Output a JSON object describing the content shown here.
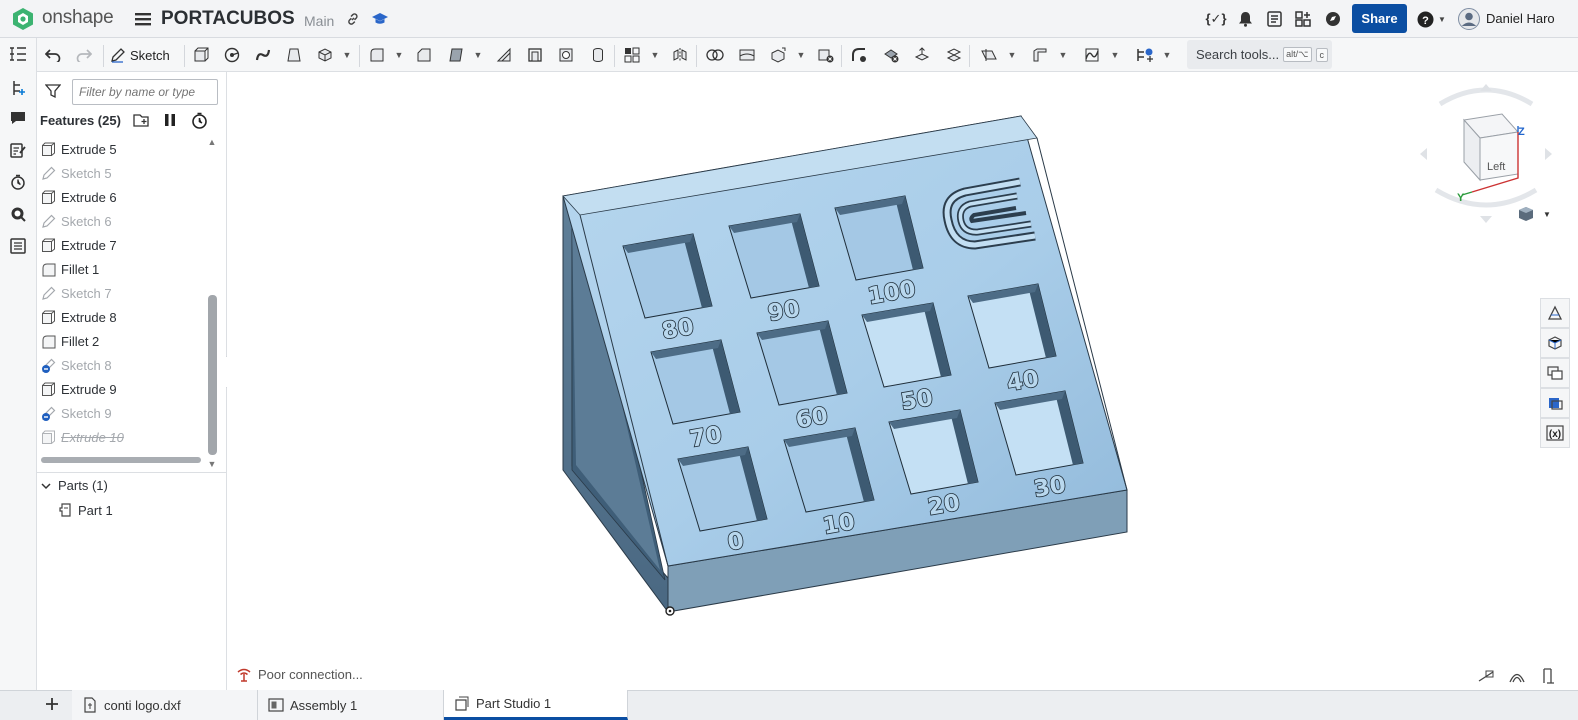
{
  "app": {
    "brand": "onshape",
    "document_title": "PORTACUBOS",
    "branch": "Main",
    "share_label": "Share",
    "user_name": "Daniel Haro",
    "accent_color": "#0b4ea2",
    "brand_color": "#3cb371"
  },
  "toolbar": {
    "sketch_label": "Sketch",
    "search_label": "Search tools...",
    "search_shortcut_1": "alt/⌥",
    "search_shortcut_2": "c"
  },
  "features": {
    "filter_placeholder": "Filter by name or type",
    "header": "Features (25)",
    "items": [
      {
        "label": "Extrude 5",
        "kind": "extrude"
      },
      {
        "label": "Sketch 5",
        "kind": "sketch"
      },
      {
        "label": "Extrude 6",
        "kind": "extrude"
      },
      {
        "label": "Sketch 6",
        "kind": "sketch"
      },
      {
        "label": "Extrude 7",
        "kind": "extrude"
      },
      {
        "label": "Fillet 1",
        "kind": "fillet"
      },
      {
        "label": "Sketch 7",
        "kind": "sketch"
      },
      {
        "label": "Extrude 8",
        "kind": "extrude"
      },
      {
        "label": "Fillet 2",
        "kind": "fillet"
      },
      {
        "label": "Sketch 8",
        "kind": "sketch-error"
      },
      {
        "label": "Extrude 9",
        "kind": "extrude"
      },
      {
        "label": "Sketch 9",
        "kind": "sketch-error"
      },
      {
        "label": "Extrude 10",
        "kind": "suppressed"
      }
    ],
    "parts_header": "Parts (1)",
    "parts": [
      "Part 1"
    ]
  },
  "model": {
    "labels": [
      "80",
      "90",
      "100",
      "70",
      "60",
      "50",
      "40",
      "0",
      "10",
      "20",
      "30"
    ]
  },
  "viewcube": {
    "face_label": "Left",
    "axis_z": "Z",
    "axis_y": "Y"
  },
  "status": {
    "connection": "Poor connection..."
  },
  "tabs": [
    {
      "label": "conti logo.dxf"
    },
    {
      "label": "Assembly 1"
    },
    {
      "label": "Part Studio 1",
      "active": true
    }
  ]
}
